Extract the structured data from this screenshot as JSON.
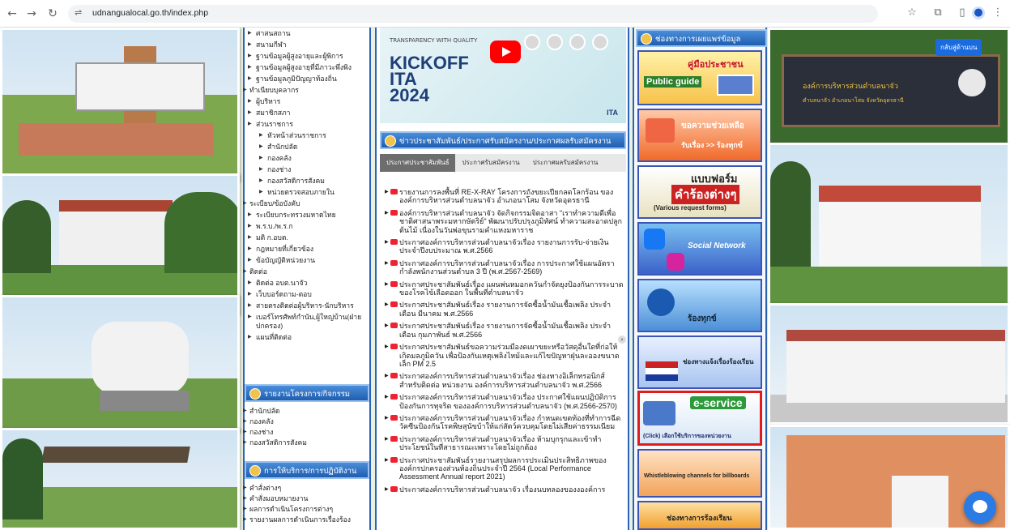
{
  "browser": {
    "url": "udnangualocal.go.th/index.php"
  },
  "nav": {
    "items": [
      {
        "label": "ศาสนสถาน",
        "lvl": 1
      },
      {
        "label": "สนามกีฬา",
        "lvl": 1
      },
      {
        "label": "ฐานข้อมูลผู้สูงอายุและผู้พิการ",
        "lvl": 1
      },
      {
        "label": "ฐานข้อมูลผู้สูงอายุที่มีภาวะพึ่งพิง",
        "lvl": 1
      },
      {
        "label": "ฐานข้อมูลภูมิปัญญาท้องถิ่น",
        "lvl": 1
      },
      {
        "label": "ทำเนียบบุคลากร",
        "lvl": 0
      },
      {
        "label": "ผู้บริหาร",
        "lvl": 1
      },
      {
        "label": "สมาชิกสภา",
        "lvl": 1
      },
      {
        "label": "ส่วนราชการ",
        "lvl": 1
      },
      {
        "label": "หัวหน้าส่วนราชการ",
        "lvl": 2
      },
      {
        "label": "สำนักปลัด",
        "lvl": 2
      },
      {
        "label": "กองคลัง",
        "lvl": 2
      },
      {
        "label": "กองช่าง",
        "lvl": 2
      },
      {
        "label": "กองสวัสดิการสังคม",
        "lvl": 2
      },
      {
        "label": "หน่วยตรวจสอบภายใน",
        "lvl": 2
      },
      {
        "label": "ระเบียบ/ข้อบังคับ",
        "lvl": 0
      },
      {
        "label": "ระเบียบกระทรวงมหาดไทย",
        "lvl": 1
      },
      {
        "label": "พ.ร.บ./พ.ร.ก",
        "lvl": 1
      },
      {
        "label": "มติ ก.อบต.",
        "lvl": 1
      },
      {
        "label": "กฎหมายที่เกี่ยวข้อง",
        "lvl": 1
      },
      {
        "label": "ข้อบัญญัติหน่วยงาน",
        "lvl": 1
      },
      {
        "label": "ติดต่อ",
        "lvl": 0
      },
      {
        "label": "ติดต่อ อบต.นาจัว",
        "lvl": 1
      },
      {
        "label": "เว็บบอร์ดถาม-ตอบ",
        "lvl": 1
      },
      {
        "label": "สายตรงติดต่อผู้บริหาร-นักบริหาร",
        "lvl": 1
      },
      {
        "label": "เบอร์โทรศัพท์กำนัน,ผู้ใหญ่บ้าน(ฝ่ายปกครอง)",
        "lvl": 1
      },
      {
        "label": "แผนที่ติดต่อ",
        "lvl": 1
      }
    ],
    "box2_title": "รายงานโครงการ/กิจกรรม",
    "box2_items": [
      "สำนักปลัด",
      "กองคลัง",
      "กองช่าง",
      "กองสวัสดิการสังคม"
    ],
    "box3_title": "การให้บริการ/การปฏิบัติงาน",
    "box3_items": [
      "คำสั่งต่างๆ",
      "คำสั่งมอบหมายงาน",
      "ผลการดำเนินโครงการต่างๆ",
      "รายงานผลการดำเนินการเรื่องร้อง"
    ]
  },
  "banner": {
    "kick": "KICKOFF",
    "ita": "ITA",
    "year": "2024",
    "top": "TRANSPARENCY WITH QUALITY",
    "brand": "ITA"
  },
  "news": {
    "title": "ข่าวประชาสัมพันธ์/ประกาศรับสมัครงาน/ประกาศผลรับสมัครงาน",
    "tabs": [
      "ประกาศประชาสัมพันธ์",
      "ประกาศรับสมัครงาน",
      "ประกาศผลรับสมัครงาน"
    ],
    "items": [
      "รายงานการลงพื้นที่ RE-X-RAY โครงการถังขยะเปียกลดโลกร้อน ของ องค์การบริหารส่วนตำบลนาจัว อำเภอนาโสม จังหวัดอุดรธานี",
      "องค์การบริหารส่วนตำบลนาจัว จัดกิจกรรมจิตอาสา \"เราทำความดีเพื่อชาติศาสนาพระมหากษัตริย์\" พัฒนาปรับปรุงภูมิทัศน์ ทำความสะอาดปลูกต้นไม้ เนื่องในวันพ่อขุนรามคำแหงมหาราช",
      "ประกาศองค์การบริหารส่วนตำบลนาจัวเรื่อง รายงานการรับ-จ่ายเงินประจำปีงบประมาณ พ.ศ.2566",
      "ประกาศองค์การบริหารส่วนตำบลนาจัวเรื่อง การประกาศใช้แผนอัตรากำลังพนักงานส่วนตำบล 3 ปี (พ.ศ.2567-2569)",
      "ประกาศประชาสัมพันธ์เรื่อง แผนพ่นหมอกควันกำจัดยุงป้องกันการระบาดของโรคไข้เลือดออก ในพื้นที่ตำบลนาจัว",
      "ประกาศประชาสัมพันธ์เรื่อง รายงานการจัดซื้อน้ำมันเชื้อเพลิง ประจำเดือน มีนาคม พ.ศ.2566",
      "ประกาศประชาสัมพันธ์เรื่อง รายงานการจัดซื้อน้ำมันเชื้อเพลิง ประจำเดือน กุมภาพันธ์ พ.ศ.2566",
      "ประกาศประชาสัมพันธ์ขอความร่วมมืองดเผาขยะหรือวัสดุอื่นใดที่ก่อให้เกิดมลภูมิควัน เพื่อป้องกันเหตุเพลิงไหม้และแก้ไขปัญหาฝุ่นละอองขนาดเล็ก PM 2.5",
      "ประกาศองค์การบริหารส่วนตำบลนาจัวเรื่อง ช่องทางอิเล็กทรอนิกส์สำหรับติดต่อ หน่วยงาน องค์การบริหารส่วนตำบลนาจัว พ.ศ.2566",
      "ประกาศองค์การบริหารส่วนตำบลนาจัวเรื่อง ประกาศใช้แผนปฏิบัติการป้องกันการทุจริต ขององค์การบริหารส่วนตำบลนาจัว (พ.ศ.2566-2570)",
      "ประกาศองค์การบริหารส่วนตำบลนาจัวเรื่อง กำหนดเขตท้องที่ทำการฉีดวัคซีนป้องกันโรคพิษสุนัขบ้าให้แก่สัตว์ควบคุมโดยไม่เสียค่าธรรมเนียม",
      "ประกาศองค์การบริหารส่วนตำบลนาจัวเรื่อง ห้ามบุกรุกและเข้าทำประโยชน์ในที่สาธารณะเพราะโดยไม่ถูกต้อง",
      "ประกาศประชาสัมพันธ์รายงานสรุปผลการประเมินประสิทธิภาพขององค์กรปกครองส่วนท้องถิ่นประจำปี 2564 (Local Performance Assessment Annual report 2021)",
      "ประกาศองค์การบริหารส่วนตำบลนาจัว เรื่องนบทลองของงองค์การ"
    ]
  },
  "right": {
    "title": "ช่องทางการเผยแพร่ข้อมูล",
    "ads": [
      {
        "a": "คู่มือประชาชน",
        "b": "Public guide"
      },
      {
        "a": "ขอความช่วยเหลือ",
        "b": "รับเรื่อง >> ร้องทุกข์"
      },
      {
        "a": "แบบฟอร์ม",
        "b": "คำร้องต่างๆ",
        "c": "(Various request forms)"
      },
      {
        "a": "Social Network",
        "b": ""
      },
      {
        "a": "ร้องทุกข์",
        "b": ""
      },
      {
        "a": "ช่องทางแจ้งเรื่องร้องเรียน",
        "b": ""
      },
      {
        "a": "e-service",
        "b": "(Click) เลือกใช้บริการของหน่วยงาน"
      },
      {
        "a": "Whistleblowing channels for billboards",
        "b": ""
      },
      {
        "a": "ช่องทางการร้องเรียน",
        "b": ""
      }
    ]
  },
  "back_btn": "กลับสู่ด้านบน",
  "sign": {
    "l1": "องค์การบริหารส่วนตำบลนาจัว",
    "l2": "ตำบลนาจัว อำเภอนาโสม จังหวัดอุดรธานี"
  }
}
